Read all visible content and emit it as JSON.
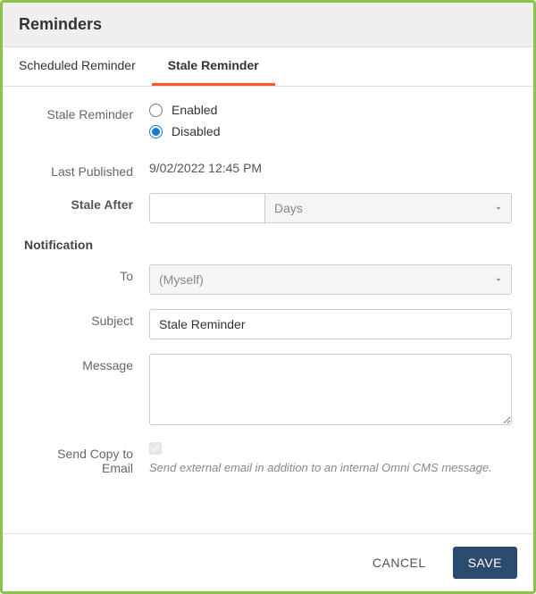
{
  "title": "Reminders",
  "tabs": {
    "scheduled": "Scheduled Reminder",
    "stale": "Stale Reminder"
  },
  "staleReminder": {
    "label": "Stale Reminder",
    "enabledLabel": "Enabled",
    "disabledLabel": "Disabled",
    "selected": "disabled"
  },
  "lastPublished": {
    "label": "Last Published",
    "value": "9/02/2022 12:45 PM"
  },
  "staleAfter": {
    "label": "Stale After",
    "amount": "",
    "unit": "Days"
  },
  "notification": {
    "heading": "Notification",
    "to": {
      "label": "To",
      "value": "(Myself)"
    },
    "subject": {
      "label": "Subject",
      "value": "Stale Reminder"
    },
    "message": {
      "label": "Message",
      "value": ""
    },
    "sendCopy": {
      "label": "Send Copy to Email",
      "checked": true,
      "helper": "Send external email in addition to an internal Omni CMS message."
    }
  },
  "footer": {
    "cancel": "CANCEL",
    "save": "SAVE"
  }
}
